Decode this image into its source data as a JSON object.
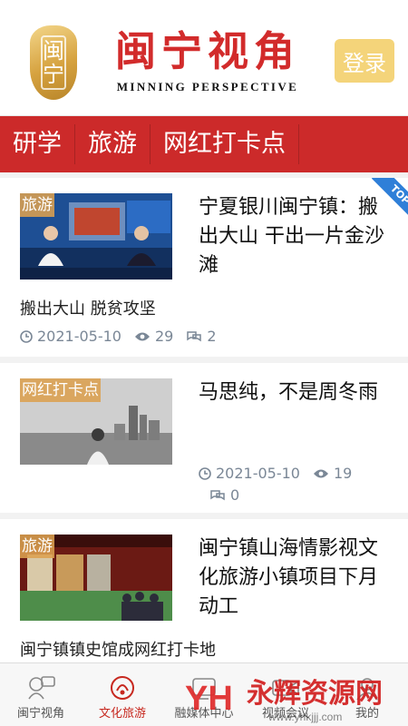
{
  "header": {
    "seal_text": "闽宁",
    "brand_cn": "闽宁视角",
    "brand_en": "MINNING  PERSPECTIVE",
    "login_label": "登录"
  },
  "tabs": [
    "研学",
    "旅游",
    "网红打卡点"
  ],
  "articles": [
    {
      "tag": "旅游",
      "title": "宁夏银川闽宁镇：搬出大山 干出一片金沙滩",
      "subtitle": "搬出大山 脱贫攻坚",
      "date": "2021-05-10",
      "views": "29",
      "comments": "2",
      "badge": "TOP"
    },
    {
      "tag": "网红打卡点",
      "title": "马思纯，不是周冬雨",
      "date": "2021-05-10",
      "views": "19",
      "comments": "0"
    },
    {
      "tag": "旅游",
      "title": "闽宁镇山海情影视文化旅游小镇项目下月动工",
      "subtitle": "闽宁镇镇史馆成网红打卡地"
    }
  ],
  "bottom_nav": [
    {
      "label": "闽宁视角",
      "icon": "chat-bubbles-icon"
    },
    {
      "label": "文化旅游",
      "icon": "culture-travel-icon",
      "active": true
    },
    {
      "label": "融媒体中心",
      "icon": "media-center-icon"
    },
    {
      "label": "视频会议",
      "icon": "video-icon"
    },
    {
      "label": "我的",
      "icon": "profile-icon"
    }
  ],
  "watermark": {
    "logo_text": "YH",
    "text_cn": "永辉资源网",
    "url": "www.yhkjjj.com"
  },
  "colors": {
    "brand_red": "#cc2a2a",
    "login_gold": "#f4d47a",
    "meta_gray": "#7a8796",
    "top_badge_blue": "#2f7fd8"
  }
}
